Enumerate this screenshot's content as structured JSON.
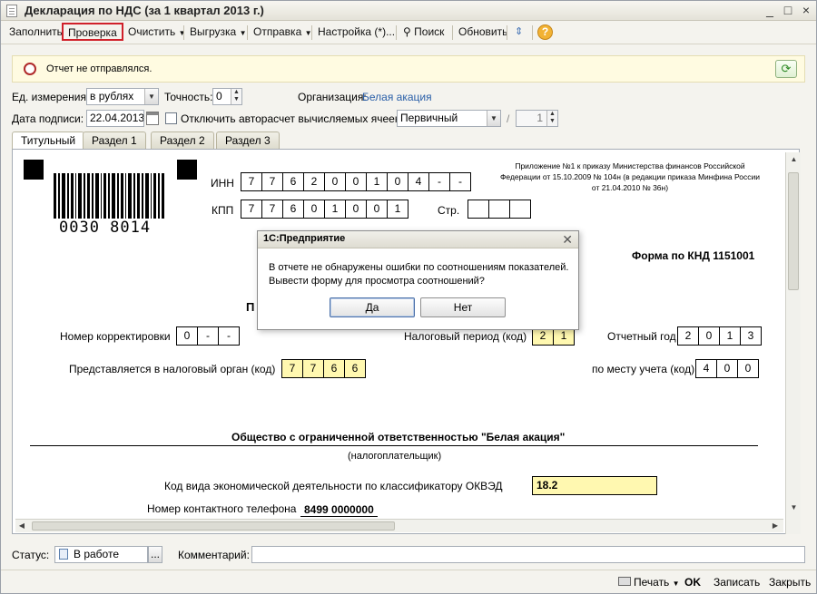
{
  "window": {
    "title": "Декларация по НДС (за 1 квартал 2013 г.)",
    "controls": [
      "_",
      "□",
      "×"
    ]
  },
  "toolbar": {
    "fill": "Заполнить",
    "check": "Проверка",
    "clear": "Очистить",
    "export": "Выгрузка",
    "send": "Отправка",
    "settings": "Настройка (*)...",
    "search": "Поиск",
    "refresh": "Обновить",
    "help": "?"
  },
  "infobar": {
    "message": "Отчет не отправлялся."
  },
  "params": {
    "units_label": "Ед. измерения:",
    "units_value": "в рублях",
    "precision_label": "Точность:",
    "precision_value": "0",
    "org_label": "Организация:",
    "org_value": "Белая акация",
    "date_label": "Дата подписи:",
    "date_value": "22.04.2013",
    "autocalc_label": "Отключить авторасчет вычисляемых ячеек",
    "type_value": "Первичный",
    "corr_sep": "/",
    "corr_value": "1"
  },
  "tabs": [
    "Титульный",
    "Раздел 1",
    "Раздел 2",
    "Раздел 3"
  ],
  "form": {
    "barcode_number": "0030 8014",
    "inn_label": "ИНН",
    "inn": [
      "7",
      "7",
      "6",
      "2",
      "0",
      "0",
      "1",
      "0",
      "4",
      "-",
      "-"
    ],
    "kpp_label": "КПП",
    "kpp": [
      "7",
      "7",
      "6",
      "0",
      "1",
      "0",
      "0",
      "1"
    ],
    "page_label": "Стр.",
    "page": [
      "",
      "",
      ""
    ],
    "appendix_note": "Приложение №1 к приказу Министерства финансов Российской Федерации от 15.10.2009 № 104н (в редакции приказа Минфина России от 21.04.2010 № 36н)",
    "knd": "Форма по КНД 1151001",
    "hidden_heading_fragment": "П",
    "correction_label": "Номер корректировки",
    "correction": [
      "0",
      "-",
      "-"
    ],
    "tax_period_label": "Налоговый период (код)",
    "tax_period": [
      "2",
      "1"
    ],
    "report_year_label": "Отчетный год",
    "report_year": [
      "2",
      "0",
      "1",
      "3"
    ],
    "tax_authority_label": "Представляется в налоговый орган (код)",
    "tax_authority": [
      "7",
      "7",
      "6",
      "6"
    ],
    "accounting_place_label": "по месту учета (код)",
    "accounting_place": [
      "4",
      "0",
      "0"
    ],
    "taxpayer_name": "Общество с ограниченной ответственностью \"Белая акация\"",
    "taxpayer_caption": "(налогоплательщик)",
    "okved_label": "Код вида экономической деятельности по классификатору ОКВЭД",
    "okved_value": "18.2",
    "phone_label": "Номер контактного телефона",
    "phone_value": "8499 0000000"
  },
  "dialog": {
    "title": "1С:Предприятие",
    "line1": "В отчете не обнаружены ошибки по соотношениям показателей.",
    "line2": "Вывести форму для просмотра соотношений?",
    "yes": "Да",
    "no": "Нет"
  },
  "status": {
    "label": "Статус:",
    "value": "В работе",
    "more": "...",
    "comment_label": "Комментарий:",
    "comment_value": ""
  },
  "footer": {
    "print": "Печать",
    "ok": "OK",
    "save": "Записать",
    "close": "Закрыть"
  },
  "colors": {
    "check_highlight": "#d0202a",
    "yellow_cell": "#fff8b0",
    "link": "#2a5fa8"
  }
}
